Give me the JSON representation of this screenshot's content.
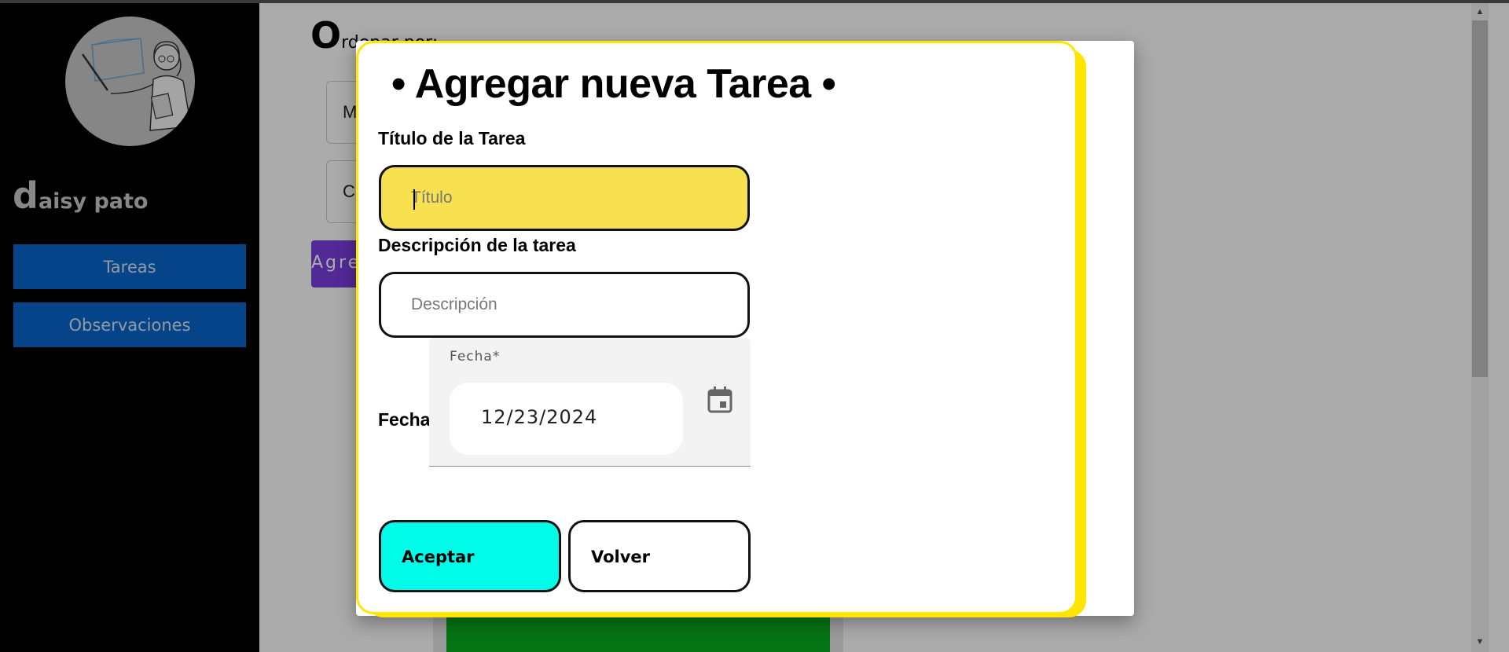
{
  "sidebar": {
    "user_initial": "d",
    "user_rest": "aisy pato",
    "items": [
      {
        "label": "Tareas"
      },
      {
        "label": "Observaciones"
      }
    ]
  },
  "background": {
    "order_initial": "O",
    "order_rest": "rdenar por:",
    "select1_text": "M",
    "select2_text": "C",
    "add_button_text": "Agre"
  },
  "modal": {
    "title": "• Agregar nueva Tarea •",
    "title_label": "Título de la Tarea",
    "title_placeholder": "Título",
    "description_label": "Descripción de la tarea",
    "description_placeholder": "Descripción",
    "date_label": "Fecha",
    "date_floating_label": "Fecha*",
    "date_value": "12/23/2024",
    "accept_label": "Aceptar",
    "back_label": "Volver"
  },
  "icons": {
    "calendar": "calendar-icon",
    "scroll_up": "scroll-up-arrow-icon",
    "scroll_down": "scroll-down-arrow-icon"
  },
  "colors": {
    "sidebar_button": "#0a66cc",
    "modal_border": "#ffe600",
    "title_input_bg": "#f8e150",
    "accept_button": "#00fce8",
    "green_card": "#07ad1f",
    "add_button": "#7b3fe0"
  }
}
